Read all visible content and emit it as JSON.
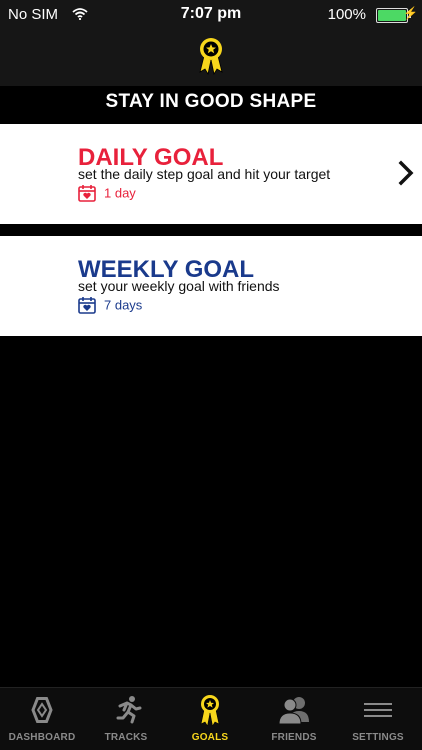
{
  "status_bar": {
    "carrier": "No SIM",
    "time": "7:07 pm",
    "battery_pct": "100%"
  },
  "header": {
    "title": "STAY IN GOOD SHAPE"
  },
  "goals": [
    {
      "title": "DAILY GOAL",
      "description": "set the daily step goal and hit your target",
      "duration": "1 day",
      "color": "#e8213b"
    },
    {
      "title": "WEEKLY GOAL",
      "description": "set your weekly goal with friends",
      "duration": "7 days",
      "color": "#1a3a8c"
    }
  ],
  "tab_bar": {
    "active": "GOALS",
    "items": [
      {
        "label": "DASHBOARD",
        "icon": "dashboard-icon"
      },
      {
        "label": "TRACKS",
        "icon": "runner-icon"
      },
      {
        "label": "GOALS",
        "icon": "ribbon-icon"
      },
      {
        "label": "FRIENDS",
        "icon": "friends-icon"
      },
      {
        "label": "SETTINGS",
        "icon": "menu-icon"
      }
    ]
  },
  "colors": {
    "accent": "#f7d61c",
    "daily": "#e8213b",
    "weekly": "#1a3a8c"
  }
}
